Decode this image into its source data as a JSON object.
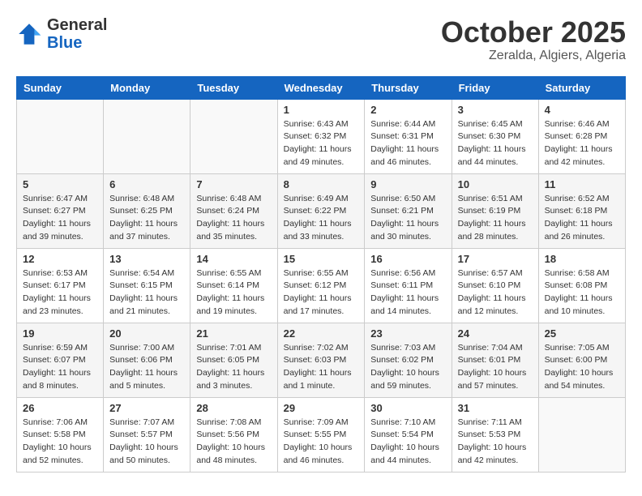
{
  "logo": {
    "general": "General",
    "blue": "Blue"
  },
  "header": {
    "month_year": "October 2025",
    "location": "Zeralda, Algiers, Algeria"
  },
  "weekdays": [
    "Sunday",
    "Monday",
    "Tuesday",
    "Wednesday",
    "Thursday",
    "Friday",
    "Saturday"
  ],
  "weeks": [
    [
      {
        "day": "",
        "sunrise": "",
        "sunset": "",
        "daylight": ""
      },
      {
        "day": "",
        "sunrise": "",
        "sunset": "",
        "daylight": ""
      },
      {
        "day": "",
        "sunrise": "",
        "sunset": "",
        "daylight": ""
      },
      {
        "day": "1",
        "sunrise": "Sunrise: 6:43 AM",
        "sunset": "Sunset: 6:32 PM",
        "daylight": "Daylight: 11 hours and 49 minutes."
      },
      {
        "day": "2",
        "sunrise": "Sunrise: 6:44 AM",
        "sunset": "Sunset: 6:31 PM",
        "daylight": "Daylight: 11 hours and 46 minutes."
      },
      {
        "day": "3",
        "sunrise": "Sunrise: 6:45 AM",
        "sunset": "Sunset: 6:30 PM",
        "daylight": "Daylight: 11 hours and 44 minutes."
      },
      {
        "day": "4",
        "sunrise": "Sunrise: 6:46 AM",
        "sunset": "Sunset: 6:28 PM",
        "daylight": "Daylight: 11 hours and 42 minutes."
      }
    ],
    [
      {
        "day": "5",
        "sunrise": "Sunrise: 6:47 AM",
        "sunset": "Sunset: 6:27 PM",
        "daylight": "Daylight: 11 hours and 39 minutes."
      },
      {
        "day": "6",
        "sunrise": "Sunrise: 6:48 AM",
        "sunset": "Sunset: 6:25 PM",
        "daylight": "Daylight: 11 hours and 37 minutes."
      },
      {
        "day": "7",
        "sunrise": "Sunrise: 6:48 AM",
        "sunset": "Sunset: 6:24 PM",
        "daylight": "Daylight: 11 hours and 35 minutes."
      },
      {
        "day": "8",
        "sunrise": "Sunrise: 6:49 AM",
        "sunset": "Sunset: 6:22 PM",
        "daylight": "Daylight: 11 hours and 33 minutes."
      },
      {
        "day": "9",
        "sunrise": "Sunrise: 6:50 AM",
        "sunset": "Sunset: 6:21 PM",
        "daylight": "Daylight: 11 hours and 30 minutes."
      },
      {
        "day": "10",
        "sunrise": "Sunrise: 6:51 AM",
        "sunset": "Sunset: 6:19 PM",
        "daylight": "Daylight: 11 hours and 28 minutes."
      },
      {
        "day": "11",
        "sunrise": "Sunrise: 6:52 AM",
        "sunset": "Sunset: 6:18 PM",
        "daylight": "Daylight: 11 hours and 26 minutes."
      }
    ],
    [
      {
        "day": "12",
        "sunrise": "Sunrise: 6:53 AM",
        "sunset": "Sunset: 6:17 PM",
        "daylight": "Daylight: 11 hours and 23 minutes."
      },
      {
        "day": "13",
        "sunrise": "Sunrise: 6:54 AM",
        "sunset": "Sunset: 6:15 PM",
        "daylight": "Daylight: 11 hours and 21 minutes."
      },
      {
        "day": "14",
        "sunrise": "Sunrise: 6:55 AM",
        "sunset": "Sunset: 6:14 PM",
        "daylight": "Daylight: 11 hours and 19 minutes."
      },
      {
        "day": "15",
        "sunrise": "Sunrise: 6:55 AM",
        "sunset": "Sunset: 6:12 PM",
        "daylight": "Daylight: 11 hours and 17 minutes."
      },
      {
        "day": "16",
        "sunrise": "Sunrise: 6:56 AM",
        "sunset": "Sunset: 6:11 PM",
        "daylight": "Daylight: 11 hours and 14 minutes."
      },
      {
        "day": "17",
        "sunrise": "Sunrise: 6:57 AM",
        "sunset": "Sunset: 6:10 PM",
        "daylight": "Daylight: 11 hours and 12 minutes."
      },
      {
        "day": "18",
        "sunrise": "Sunrise: 6:58 AM",
        "sunset": "Sunset: 6:08 PM",
        "daylight": "Daylight: 11 hours and 10 minutes."
      }
    ],
    [
      {
        "day": "19",
        "sunrise": "Sunrise: 6:59 AM",
        "sunset": "Sunset: 6:07 PM",
        "daylight": "Daylight: 11 hours and 8 minutes."
      },
      {
        "day": "20",
        "sunrise": "Sunrise: 7:00 AM",
        "sunset": "Sunset: 6:06 PM",
        "daylight": "Daylight: 11 hours and 5 minutes."
      },
      {
        "day": "21",
        "sunrise": "Sunrise: 7:01 AM",
        "sunset": "Sunset: 6:05 PM",
        "daylight": "Daylight: 11 hours and 3 minutes."
      },
      {
        "day": "22",
        "sunrise": "Sunrise: 7:02 AM",
        "sunset": "Sunset: 6:03 PM",
        "daylight": "Daylight: 11 hours and 1 minute."
      },
      {
        "day": "23",
        "sunrise": "Sunrise: 7:03 AM",
        "sunset": "Sunset: 6:02 PM",
        "daylight": "Daylight: 10 hours and 59 minutes."
      },
      {
        "day": "24",
        "sunrise": "Sunrise: 7:04 AM",
        "sunset": "Sunset: 6:01 PM",
        "daylight": "Daylight: 10 hours and 57 minutes."
      },
      {
        "day": "25",
        "sunrise": "Sunrise: 7:05 AM",
        "sunset": "Sunset: 6:00 PM",
        "daylight": "Daylight: 10 hours and 54 minutes."
      }
    ],
    [
      {
        "day": "26",
        "sunrise": "Sunrise: 7:06 AM",
        "sunset": "Sunset: 5:58 PM",
        "daylight": "Daylight: 10 hours and 52 minutes."
      },
      {
        "day": "27",
        "sunrise": "Sunrise: 7:07 AM",
        "sunset": "Sunset: 5:57 PM",
        "daylight": "Daylight: 10 hours and 50 minutes."
      },
      {
        "day": "28",
        "sunrise": "Sunrise: 7:08 AM",
        "sunset": "Sunset: 5:56 PM",
        "daylight": "Daylight: 10 hours and 48 minutes."
      },
      {
        "day": "29",
        "sunrise": "Sunrise: 7:09 AM",
        "sunset": "Sunset: 5:55 PM",
        "daylight": "Daylight: 10 hours and 46 minutes."
      },
      {
        "day": "30",
        "sunrise": "Sunrise: 7:10 AM",
        "sunset": "Sunset: 5:54 PM",
        "daylight": "Daylight: 10 hours and 44 minutes."
      },
      {
        "day": "31",
        "sunrise": "Sunrise: 7:11 AM",
        "sunset": "Sunset: 5:53 PM",
        "daylight": "Daylight: 10 hours and 42 minutes."
      },
      {
        "day": "",
        "sunrise": "",
        "sunset": "",
        "daylight": ""
      }
    ]
  ]
}
